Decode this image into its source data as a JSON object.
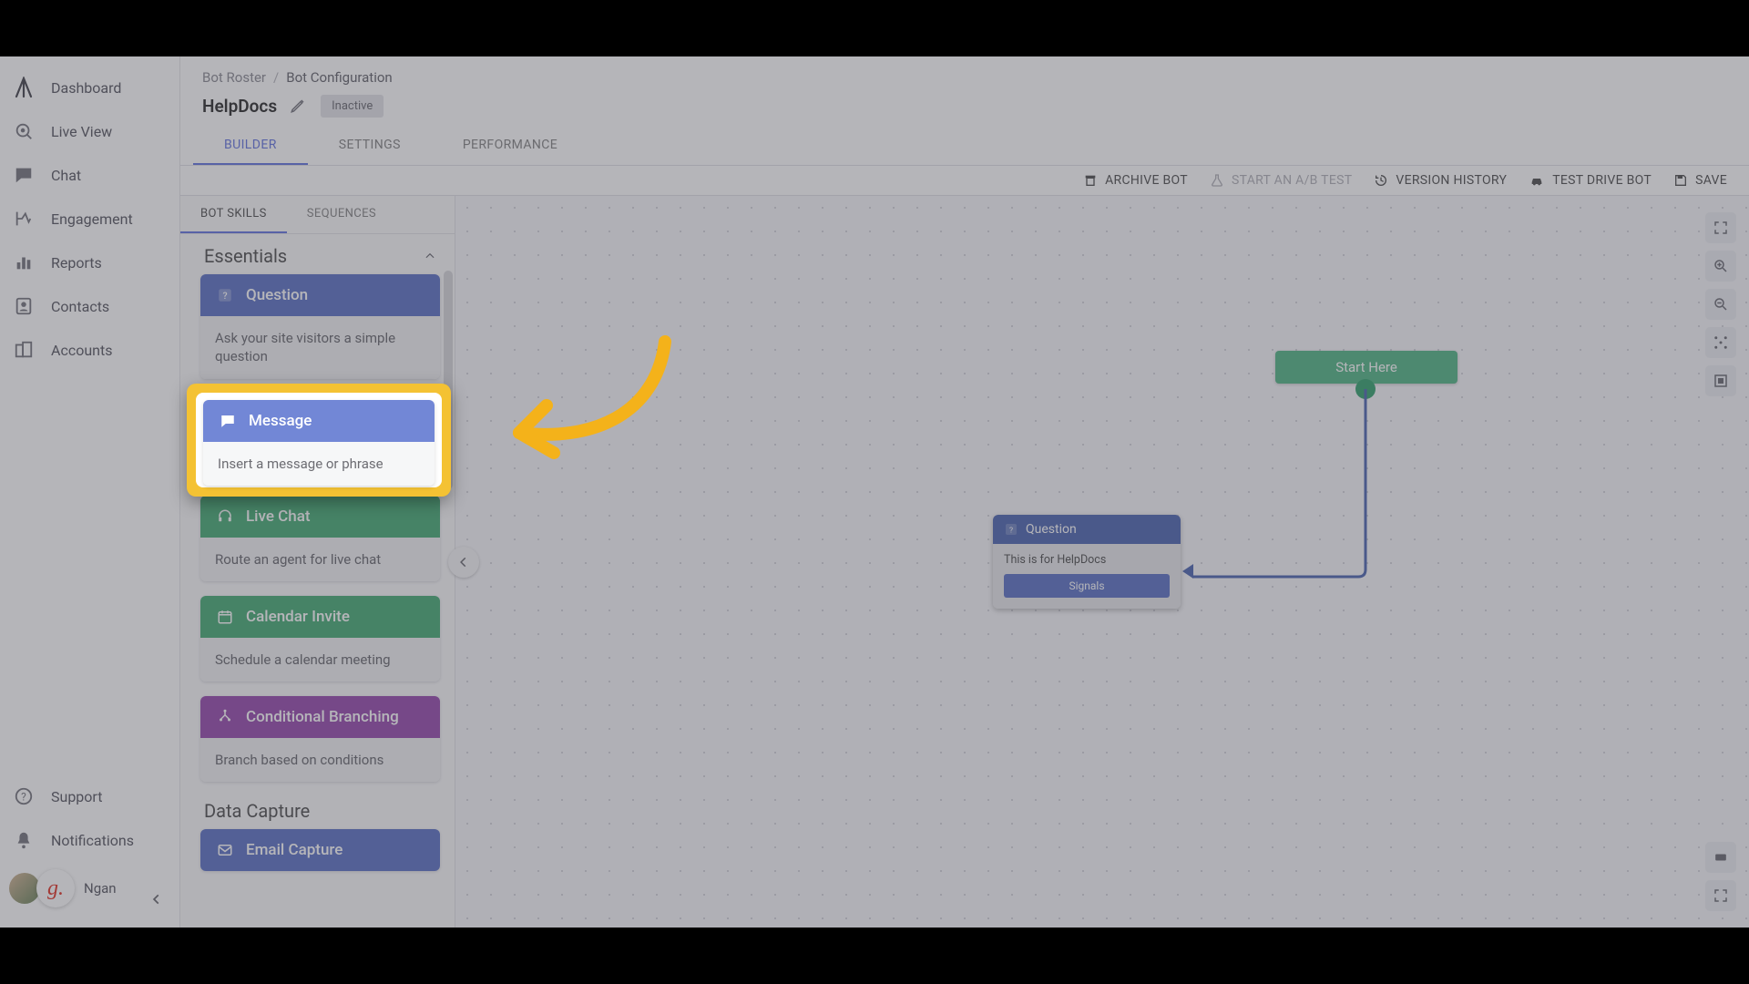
{
  "sidebar": {
    "items": [
      {
        "label": "Dashboard"
      },
      {
        "label": "Live View"
      },
      {
        "label": "Chat"
      },
      {
        "label": "Engagement"
      },
      {
        "label": "Reports"
      },
      {
        "label": "Contacts"
      },
      {
        "label": "Accounts"
      }
    ],
    "support_label": "Support",
    "notifications_label": "Notifications",
    "user_name": "Ngan",
    "g_badge": "g."
  },
  "header": {
    "crumb_root": "Bot Roster",
    "crumb_current": "Bot Configuration",
    "bot_name": "HelpDocs",
    "status": "Inactive",
    "tabs": {
      "builder": "BUILDER",
      "settings": "SETTINGS",
      "performance": "PERFORMANCE"
    },
    "actions": {
      "archive": "ARCHIVE BOT",
      "ab_test": "START AN A/B TEST",
      "version": "VERSION HISTORY",
      "test_drive": "TEST DRIVE BOT",
      "save": "SAVE"
    }
  },
  "skills": {
    "tabs": {
      "bot_skills": "BOT SKILLS",
      "sequences": "SEQUENCES"
    },
    "sections": {
      "essentials": "Essentials",
      "data_capture": "Data Capture"
    },
    "cards": {
      "question": {
        "title": "Question",
        "desc": "Ask your site visitors a simple question"
      },
      "message": {
        "title": "Message",
        "desc": "Insert a message or phrase"
      },
      "live_chat": {
        "title": "Live Chat",
        "desc": "Route an agent for live chat"
      },
      "calendar": {
        "title": "Calendar Invite",
        "desc": "Schedule a calendar meeting"
      },
      "cond": {
        "title": "Conditional Branching",
        "desc": "Branch based on conditions"
      },
      "email": {
        "title": "Email Capture",
        "desc": ""
      }
    }
  },
  "canvas": {
    "start_label": "Start Here",
    "question_node": {
      "title": "Question",
      "body": "This is for HelpDocs",
      "button": "Signals"
    }
  }
}
